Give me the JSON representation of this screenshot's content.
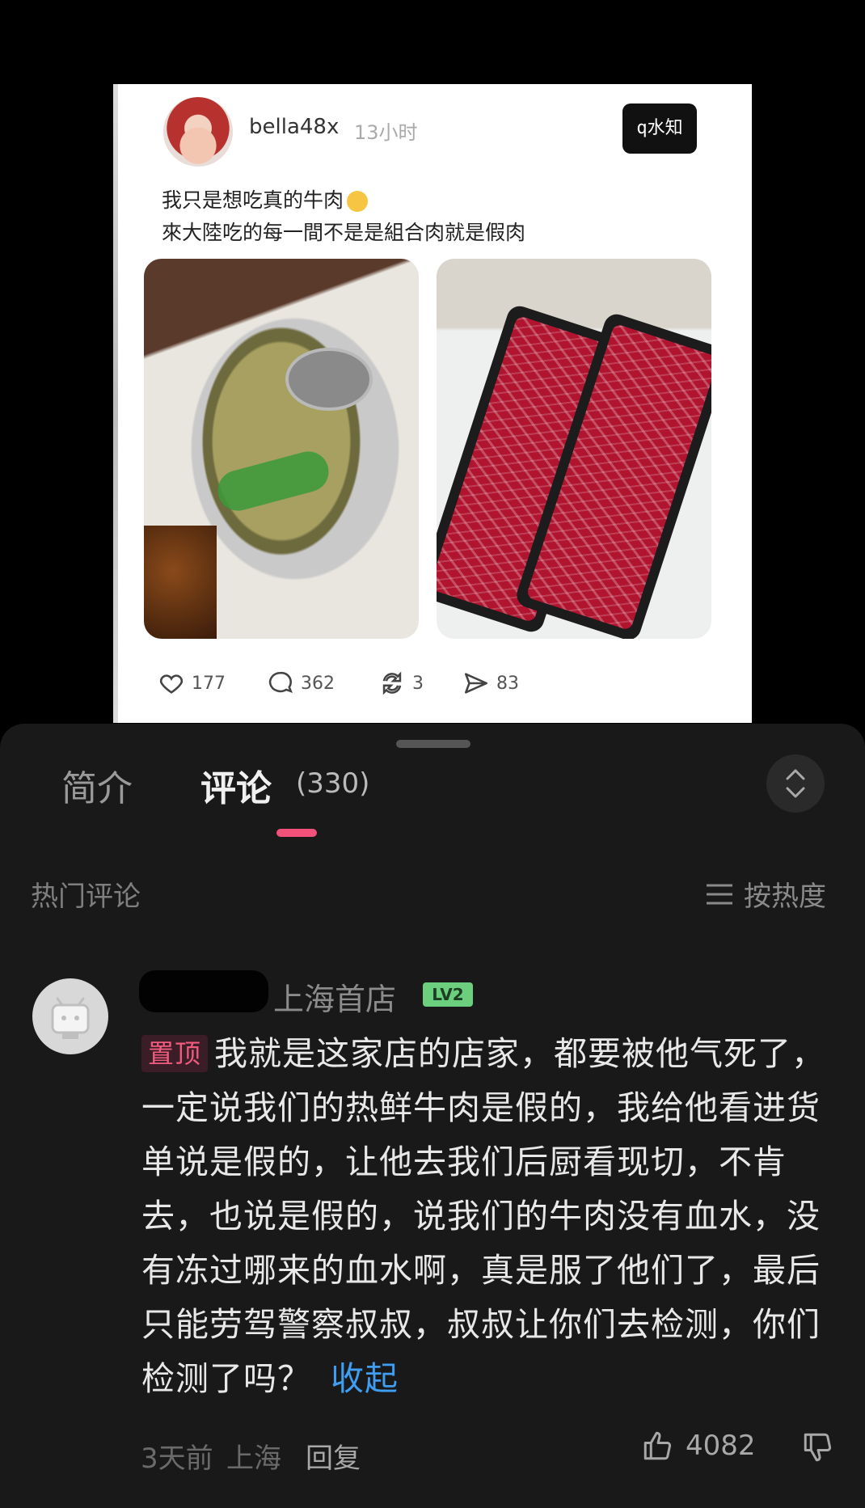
{
  "post": {
    "username": "bella48x",
    "time": "13小时",
    "logo_text": "q水知",
    "text_line_1": "我只是想吃真的牛肉",
    "text_line_2": "來大陸吃的每一間不是是組合肉就是假肉",
    "stats": {
      "likes": "177",
      "comments": "362",
      "reposts": "3",
      "shares": "83"
    }
  },
  "sheet": {
    "tabs": [
      {
        "label": "简介"
      },
      {
        "label": "评论",
        "count": "(330)"
      }
    ],
    "section_label": "热门评论",
    "sort_label": "按热度"
  },
  "comment": {
    "username": "上海首店",
    "level": "LV2",
    "pinned_tag": "置顶",
    "body": "我就是这家店的店家，都要被他气死了，一定说我们的热鲜牛肉是假的，我给他看进货单说是假的，让他去我们后厨看现切，不肯去，也说是假的，说我们的牛肉没有血水，没有冻过哪来的血水啊，真是服了他们了，最后只能劳驾警察叔叔，叔叔让你们去检测，你们检测了吗？",
    "collapse_label": "收起",
    "time": "3天前",
    "location": "上海",
    "reply_label": "回复",
    "likes": "4082"
  },
  "colors": {
    "accent": "#f2517a",
    "link": "#3f9ef2",
    "badge": "#6ccf7e",
    "sheet_bg": "#191919"
  }
}
